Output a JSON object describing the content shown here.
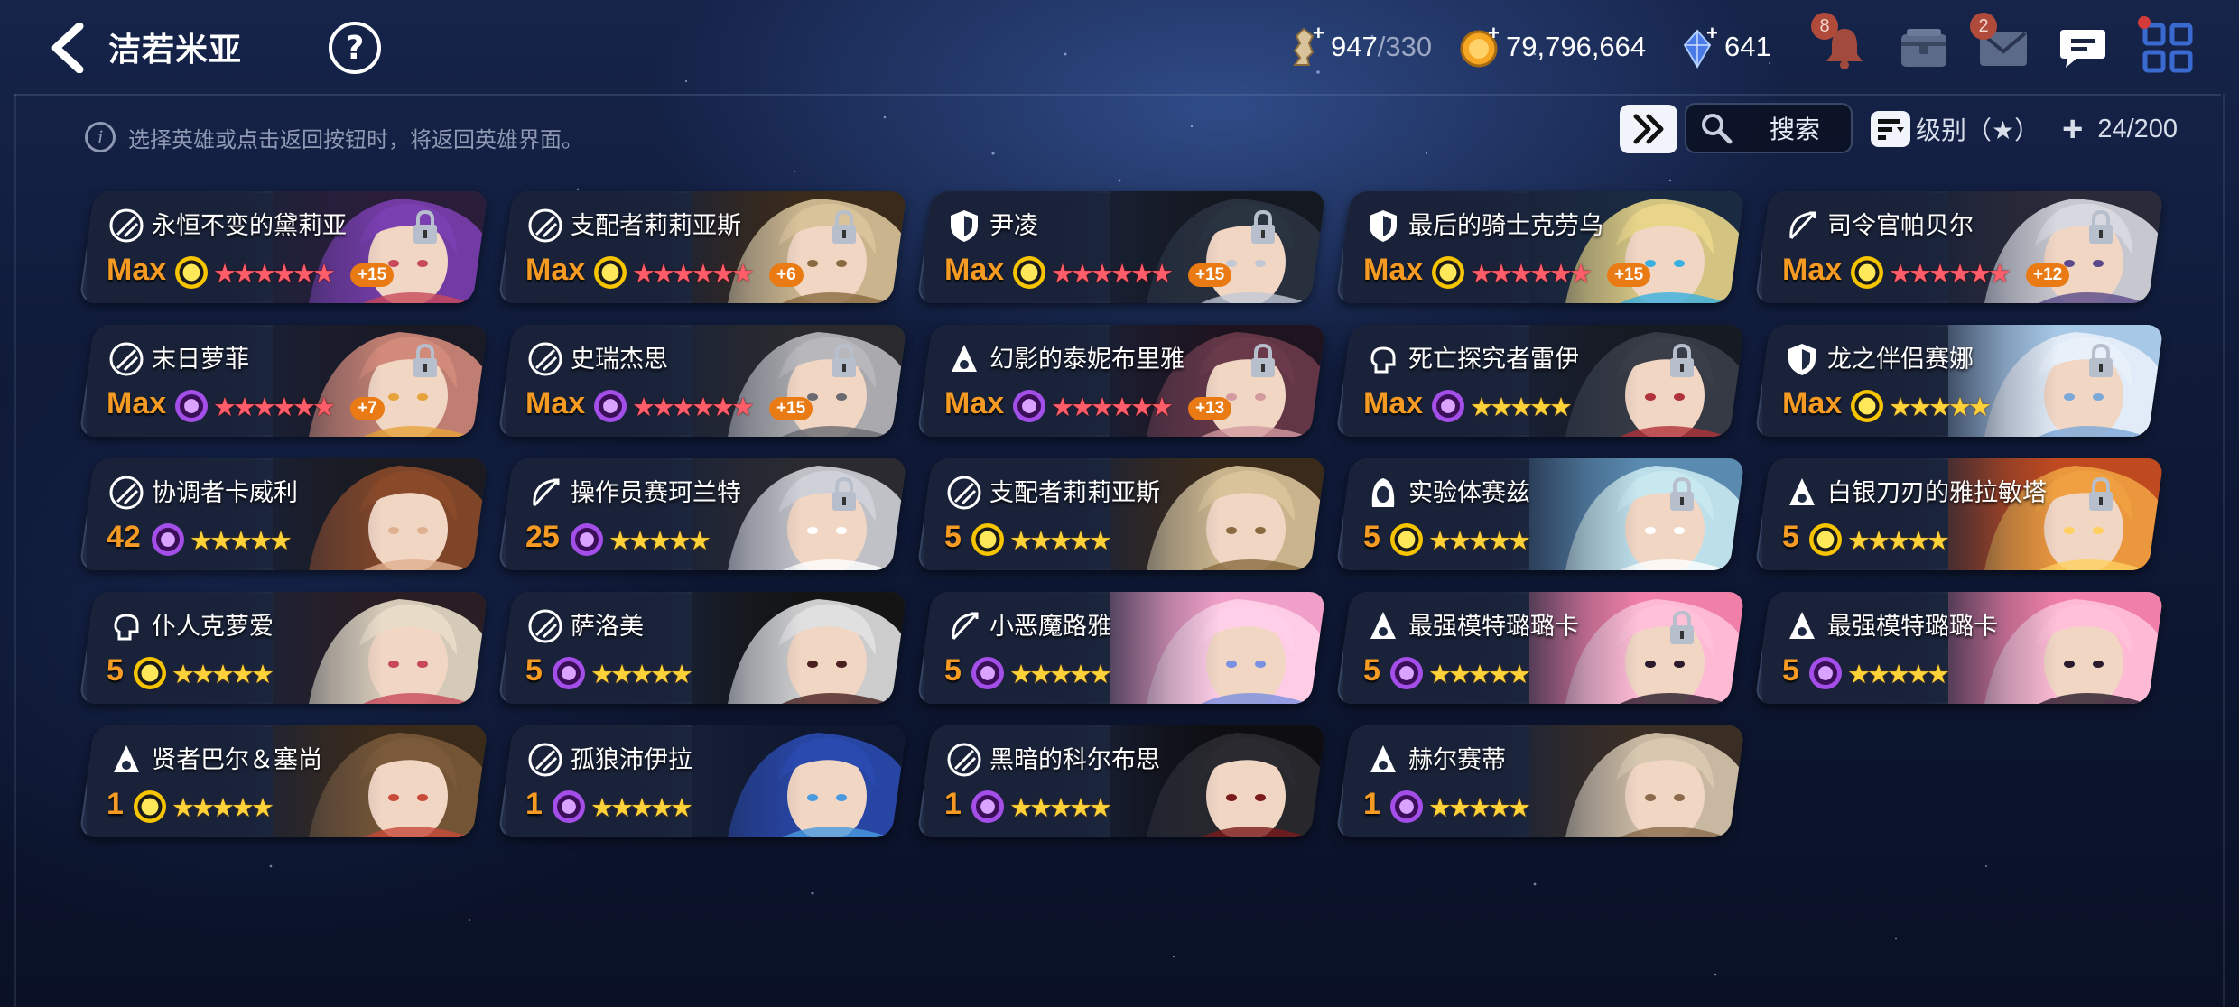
{
  "header": {
    "title": "洁若米亚",
    "help_label": "?"
  },
  "resources": {
    "stamina": "947",
    "stamina_max": "/330",
    "gold": "79,796,664",
    "crystal": "641"
  },
  "notifications": {
    "bell_count": "8",
    "mail_count": "2"
  },
  "info_text": "选择英雄或点击返回按钮时，将返回英雄界面。",
  "info_icon": "i",
  "toolbar": {
    "search_label": "搜索",
    "sort_label": "级别（★）",
    "hero_count": "24/200",
    "count_plus": "+"
  },
  "colors": {
    "level_orange": "#f59a22",
    "star_gold": "#ffd23a",
    "star_red": "#ff5d6a",
    "plus_badge": "#ea7a13"
  },
  "heroes": [
    {
      "name": "永恒不变的黛莉亚",
      "level": "Max",
      "element": "sun",
      "class": "sword",
      "stars": "★★★★★★",
      "star_color": "red",
      "plus": "+15",
      "locked": true,
      "portrait": [
        "#2a1d3a",
        "#7a3fb0",
        "#c84a5a"
      ]
    },
    {
      "name": "支配者莉莉亚斯",
      "level": "Max",
      "element": "sun",
      "class": "sword",
      "stars": "★★★★★★",
      "star_color": "red",
      "plus": "+6",
      "locked": true,
      "portrait": [
        "#3a2a1a",
        "#d9c39a",
        "#8a6a40"
      ]
    },
    {
      "name": "尹凌",
      "level": "Max",
      "element": "sun",
      "class": "shield",
      "stars": "★★★★★★",
      "star_color": "red",
      "plus": "+15",
      "locked": true,
      "portrait": [
        "#141820",
        "#2a3340",
        "#c2c8d4"
      ]
    },
    {
      "name": "最后的骑士克劳乌",
      "level": "Max",
      "element": "sun",
      "class": "shield",
      "stars": "★★★★★★",
      "star_color": "red",
      "plus": "+15",
      "locked": false,
      "portrait": [
        "#1a2a40",
        "#e8d58a",
        "#3ab0e0"
      ]
    },
    {
      "name": "司令官帕贝尔",
      "level": "Max",
      "element": "sun",
      "class": "bow",
      "stars": "★★★★★★",
      "star_color": "red",
      "plus": "+12",
      "locked": true,
      "portrait": [
        "#2a2a38",
        "#d8d8e0",
        "#5a4a8a"
      ]
    },
    {
      "name": "末日萝菲",
      "level": "Max",
      "element": "moon",
      "class": "sword",
      "stars": "★★★★★★",
      "star_color": "red",
      "plus": "+7",
      "locked": true,
      "portrait": [
        "#1a1a26",
        "#d28a7a",
        "#e7a33a"
      ]
    },
    {
      "name": "史瑞杰思",
      "level": "Max",
      "element": "moon",
      "class": "sword",
      "stars": "★★★★★★",
      "star_color": "red",
      "plus": "+15",
      "locked": true,
      "portrait": [
        "#2a2a2e",
        "#b8b8bc",
        "#6a6a70"
      ]
    },
    {
      "name": "幻影的泰妮布里雅",
      "level": "Max",
      "element": "moon",
      "class": "mage",
      "stars": "★★★★★★",
      "star_color": "red",
      "plus": "+13",
      "locked": true,
      "portrait": [
        "#1e1420",
        "#6a3a4a",
        "#d39aa0"
      ]
    },
    {
      "name": "死亡探究者雷伊",
      "level": "Max",
      "element": "moon",
      "class": "fist",
      "stars": "★★★★★",
      "star_color": "gold",
      "plus": "",
      "locked": true,
      "portrait": [
        "#161a22",
        "#3a3e48",
        "#b0323a"
      ]
    },
    {
      "name": "龙之伴侣赛娜",
      "level": "Max",
      "element": "sun",
      "class": "shield",
      "stars": "★★★★★",
      "star_color": "gold",
      "plus": "",
      "locked": true,
      "portrait": [
        "#a8c8e8",
        "#e8f0fa",
        "#7aa8d8"
      ]
    },
    {
      "name": "协调者卡威利",
      "level": "42",
      "element": "moon",
      "class": "sword",
      "stars": "★★★★★",
      "star_color": "gold",
      "plus": "",
      "locked": false,
      "portrait": [
        "#1a1a20",
        "#8a4a2a",
        "#e0b090"
      ]
    },
    {
      "name": "操作员赛珂兰特",
      "level": "25",
      "element": "moon",
      "class": "bow",
      "stars": "★★★★★",
      "star_color": "gold",
      "plus": "",
      "locked": true,
      "portrait": [
        "#2a2a30",
        "#d0d0d8",
        "#ffffff"
      ]
    },
    {
      "name": "支配者莉莉亚斯",
      "level": "5",
      "element": "sun",
      "class": "sword",
      "stars": "★★★★★",
      "star_color": "gold",
      "plus": "",
      "locked": false,
      "portrait": [
        "#3a2a1a",
        "#d9c39a",
        "#8a6a40"
      ]
    },
    {
      "name": "实验体赛兹",
      "level": "5",
      "element": "sun",
      "class": "hood",
      "stars": "★★★★★",
      "star_color": "gold",
      "plus": "",
      "locked": true,
      "portrait": [
        "#5a8ab0",
        "#c8e8f0",
        "#ffffff"
      ]
    },
    {
      "name": "白银刀刃的雅拉敏塔",
      "level": "5",
      "element": "sun",
      "class": "mage",
      "stars": "★★★★★",
      "star_color": "gold",
      "plus": "",
      "locked": true,
      "portrait": [
        "#c04a20",
        "#f0a040",
        "#ffd060"
      ]
    },
    {
      "name": "仆人克萝爱",
      "level": "5",
      "element": "sun",
      "class": "fist",
      "stars": "★★★★★",
      "star_color": "gold",
      "plus": "",
      "locked": false,
      "portrait": [
        "#2a1e24",
        "#e8dcc8",
        "#c84a5a"
      ]
    },
    {
      "name": "萨洛美",
      "level": "5",
      "element": "moon",
      "class": "sword",
      "stars": "★★★★★",
      "star_color": "gold",
      "plus": "",
      "locked": false,
      "portrait": [
        "#141414",
        "#e0e0e0",
        "#4a2020"
      ]
    },
    {
      "name": "小恶魔路雅",
      "level": "5",
      "element": "moon",
      "class": "bow",
      "stars": "★★★★★",
      "star_color": "gold",
      "plus": "",
      "locked": false,
      "portrait": [
        "#f0a0c8",
        "#ffd0e8",
        "#7a90e0"
      ]
    },
    {
      "name": "最强模特璐璐卡",
      "level": "5",
      "element": "moon",
      "class": "mage",
      "stars": "★★★★★",
      "star_color": "gold",
      "plus": "",
      "locked": true,
      "portrait": [
        "#f080a8",
        "#ffc0d8",
        "#2a1a2a"
      ]
    },
    {
      "name": "最强模特璐璐卡",
      "level": "5",
      "element": "moon",
      "class": "mage",
      "stars": "★★★★★",
      "star_color": "gold",
      "plus": "",
      "locked": false,
      "portrait": [
        "#f080a8",
        "#ffc0d8",
        "#2a1a2a"
      ]
    },
    {
      "name": "贤者巴尔＆塞尚",
      "level": "1",
      "element": "sun",
      "class": "mage",
      "stars": "★★★★★",
      "star_color": "gold",
      "plus": "",
      "locked": false,
      "portrait": [
        "#3a2a1a",
        "#7a5a3a",
        "#c84a3a"
      ]
    },
    {
      "name": "孤狼沛伊拉",
      "level": "1",
      "element": "moon",
      "class": "sword",
      "stars": "★★★★★",
      "star_color": "gold",
      "plus": "",
      "locked": false,
      "portrait": [
        "#101830",
        "#2a4ab0",
        "#4a9ae0"
      ]
    },
    {
      "name": "黑暗的科尔布思",
      "level": "1",
      "element": "moon",
      "class": "sword",
      "stars": "★★★★★",
      "star_color": "gold",
      "plus": "",
      "locked": false,
      "portrait": [
        "#0e0e12",
        "#2a2a30",
        "#7a1a1a"
      ]
    },
    {
      "name": "赫尔赛蒂",
      "level": "1",
      "element": "moon",
      "class": "mage",
      "stars": "★★★★★",
      "star_color": "gold",
      "plus": "",
      "locked": false,
      "portrait": [
        "#3a2e24",
        "#d8c8b0",
        "#8a6a4a"
      ]
    }
  ]
}
